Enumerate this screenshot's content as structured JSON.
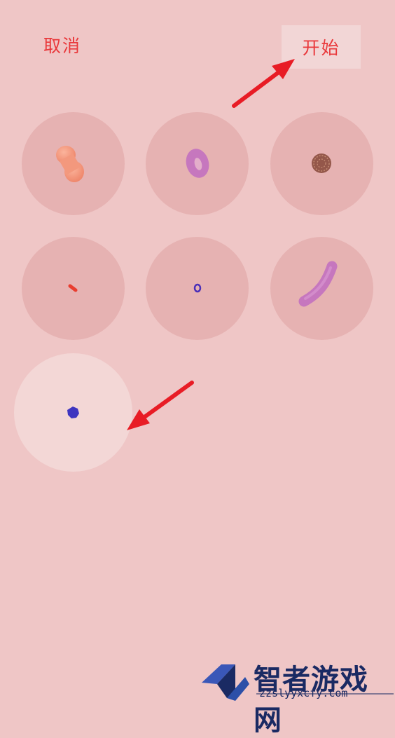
{
  "header": {
    "cancel_label": "取消",
    "start_label": "开始"
  },
  "slots": [
    {
      "name": "peanut-pill",
      "color": "#f39a84"
    },
    {
      "name": "donut",
      "color": "#c679c0"
    },
    {
      "name": "spiky-ball",
      "color": "#9b5d4f"
    },
    {
      "name": "tiny-red-dash",
      "color": "#e93d2f"
    },
    {
      "name": "tiny-blue-ring",
      "color": "#4a2fb8"
    },
    {
      "name": "long-pill",
      "color": "#c878c4"
    },
    {
      "name": "blue-dot",
      "color": "#3e35c0",
      "selected": true
    }
  ],
  "colors": {
    "background": "#efc6c6",
    "slot": "#e6b2b2",
    "slot_selected": "#f3d7d6",
    "accent_red": "#e9383b",
    "arrow": "#e81c25"
  },
  "watermark": {
    "name": "智者游戏网",
    "url": "zzslyyxcfy.com"
  }
}
